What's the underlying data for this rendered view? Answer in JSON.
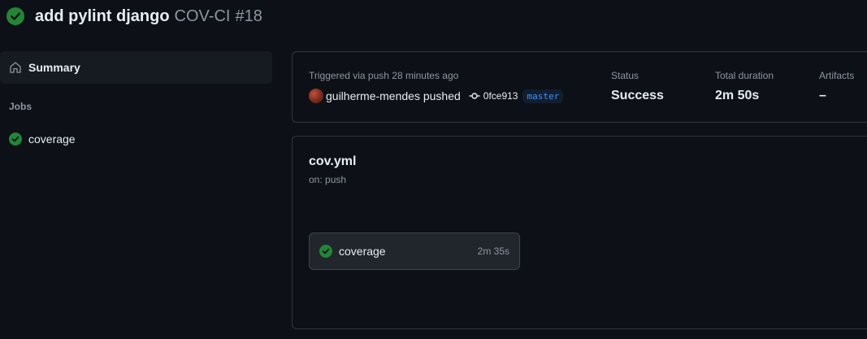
{
  "header": {
    "title": "add pylint django",
    "workflow_name": "COV-CI",
    "run_number": "#18",
    "status_icon": "check-circle-fill-icon"
  },
  "sidebar": {
    "summary_label": "Summary",
    "summary_icon": "home-icon",
    "jobs_heading": "Jobs",
    "jobs": [
      {
        "label": "coverage",
        "status": "success"
      }
    ]
  },
  "summary": {
    "trigger_text": "Triggered via push 28 minutes ago",
    "actor": "guilherme-mendes pushed",
    "commit_sha": "0fce913",
    "branch": "master",
    "status_label": "Status",
    "status_value": "Success",
    "duration_label": "Total duration",
    "duration_value": "2m 50s",
    "artifacts_label": "Artifacts",
    "artifacts_value": "–"
  },
  "workflow": {
    "file": "cov.yml",
    "trigger": "on: push",
    "jobs": [
      {
        "name": "coverage",
        "duration": "2m 35s",
        "status": "success"
      }
    ]
  },
  "colors": {
    "background": "#0d1117",
    "success": "#238636",
    "text_primary": "#e6edf3",
    "text_muted": "#8d96a0",
    "border": "#30363d",
    "link": "#4493f8"
  }
}
